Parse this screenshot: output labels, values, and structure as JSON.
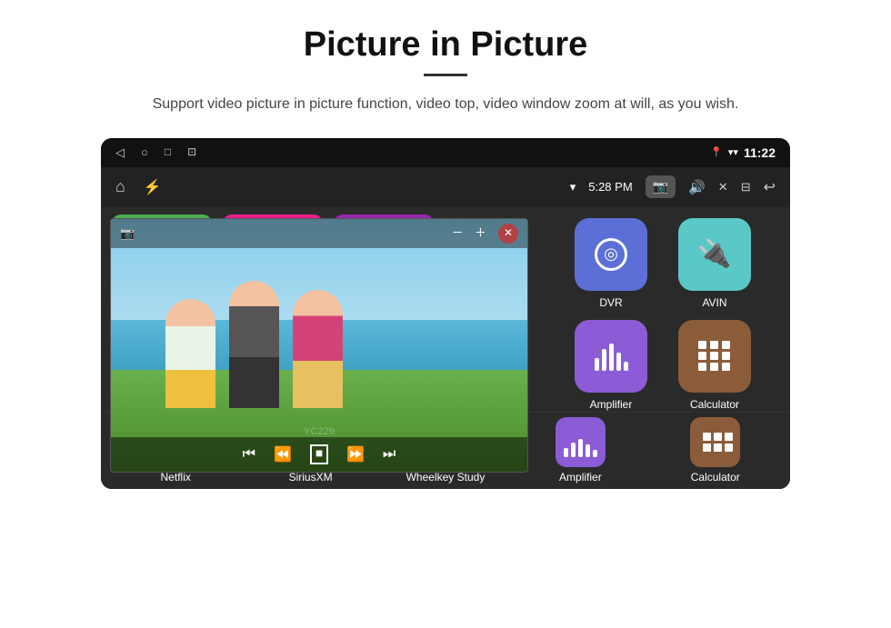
{
  "header": {
    "title": "Picture in Picture",
    "subtitle": "Support video picture in picture function, video top, video window zoom at will, as you wish."
  },
  "status_bar": {
    "time": "11:22",
    "left_icons": [
      "◁",
      "○",
      "□",
      "⊡"
    ]
  },
  "toolbar": {
    "time": "5:28 PM"
  },
  "apps_grid": {
    "row1": [
      {
        "id": "dvr",
        "label": "DVR",
        "color": "#5b6fd6"
      },
      {
        "id": "avin",
        "label": "AVIN",
        "color": "#5bc8c8"
      }
    ],
    "row2": [
      {
        "id": "amplifier",
        "label": "Amplifier",
        "color": "#8b5cd6"
      },
      {
        "id": "calculator",
        "label": "Calculator",
        "color": "#8b5c3a"
      }
    ]
  },
  "bottom_apps": [
    {
      "id": "netflix",
      "label": "Netflix",
      "color": "#4caf50"
    },
    {
      "id": "siriusxm",
      "label": "SiriusXM",
      "color": "#e91e8c"
    },
    {
      "id": "wheelkey",
      "label": "Wheelkey Study",
      "color": "#9c27b0"
    },
    {
      "id": "amplifier",
      "label": "Amplifier",
      "color": "#8b5cd6"
    },
    {
      "id": "calculator",
      "label": "Calculator",
      "color": "#8b5c3a"
    }
  ],
  "watermark": "YC229",
  "pip_controls": [
    "⏮",
    "⏪",
    "⏹",
    "⏩",
    "⏭"
  ]
}
